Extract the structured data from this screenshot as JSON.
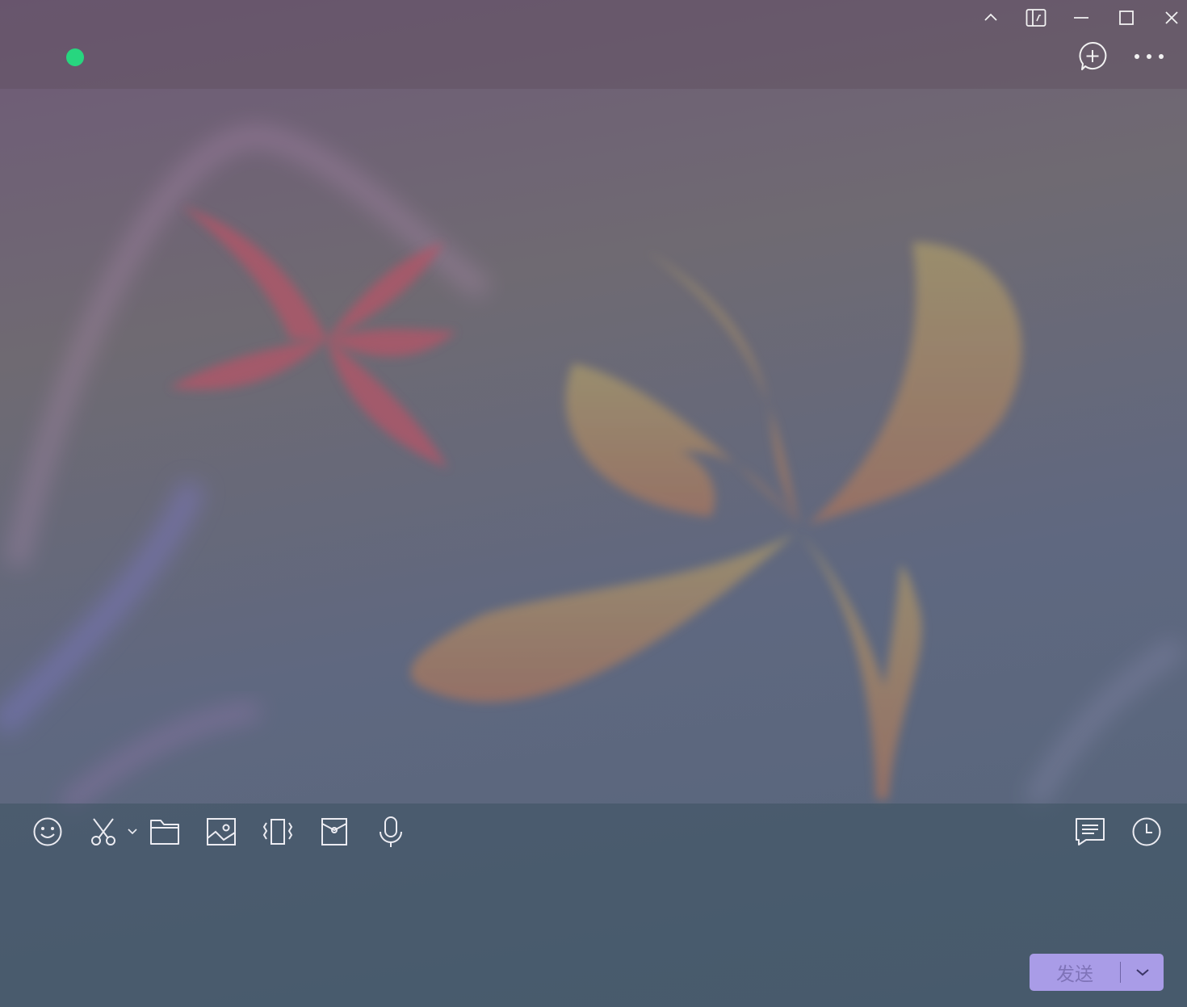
{
  "window": {
    "controls": [
      {
        "icon": "chevron-up-icon"
      },
      {
        "icon": "pin-panel-icon"
      },
      {
        "icon": "minimize-icon"
      },
      {
        "icon": "maximize-icon"
      },
      {
        "icon": "close-icon"
      }
    ]
  },
  "header": {
    "online_status_color": "#27d67f",
    "actions": [
      {
        "icon": "new-chat-icon"
      },
      {
        "icon": "more-icon"
      }
    ]
  },
  "toolbar": {
    "left": [
      {
        "icon": "emoji-icon"
      },
      {
        "icon": "screenshot-scissors-icon"
      },
      {
        "icon": "chevron-down-icon"
      },
      {
        "icon": "folder-icon"
      },
      {
        "icon": "image-icon"
      },
      {
        "icon": "vibrate-icon"
      },
      {
        "icon": "red-packet-icon"
      },
      {
        "icon": "microphone-icon"
      }
    ],
    "right": [
      {
        "icon": "chat-history-icon"
      },
      {
        "icon": "clock-icon"
      }
    ]
  },
  "composer": {
    "input_value": "",
    "send_label": "发送",
    "send_color": "#a99ce7"
  }
}
